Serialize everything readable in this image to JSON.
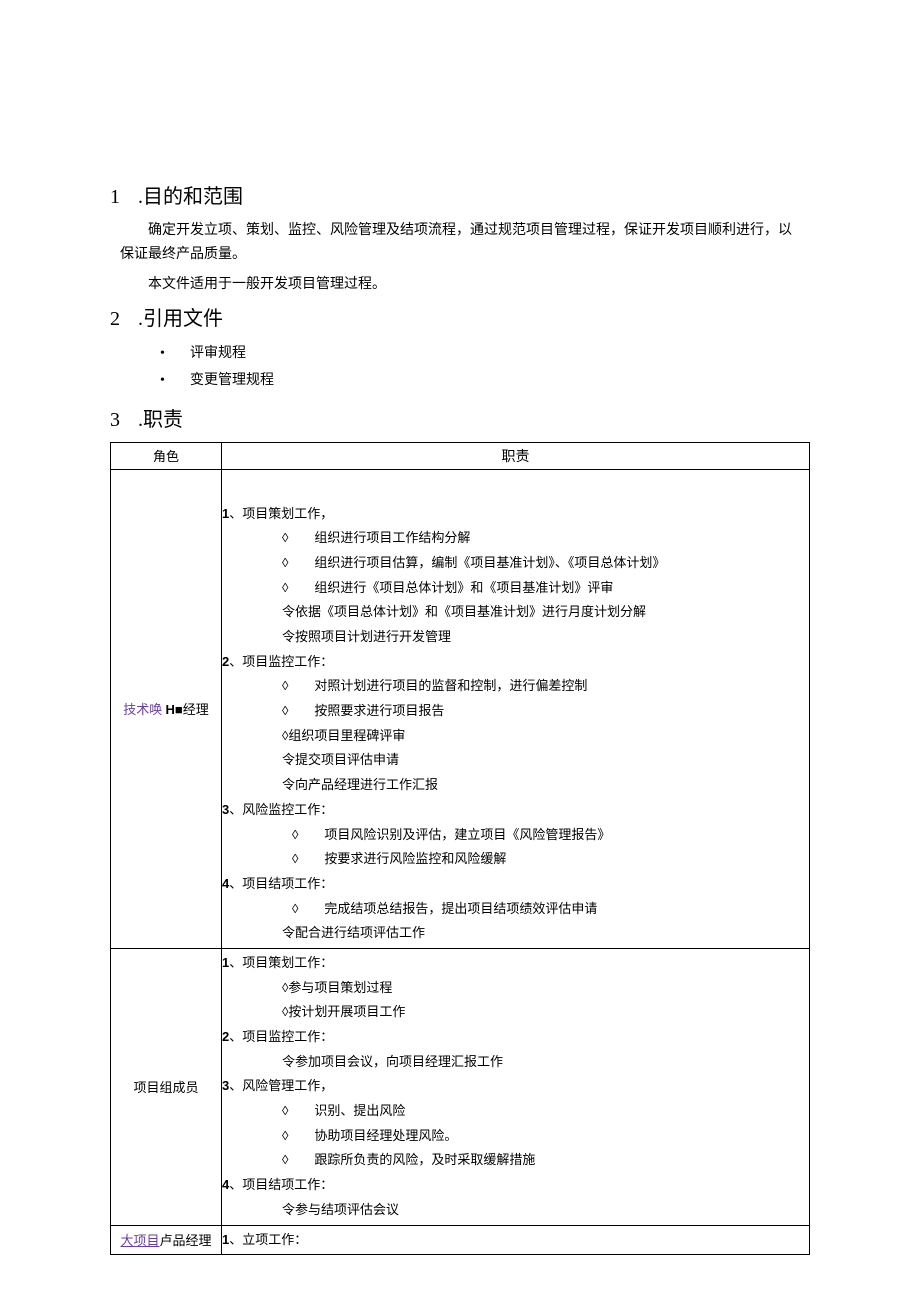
{
  "sections": {
    "s1": {
      "num": "1",
      "title": ".目的和范围",
      "p1": "确定开发立项、策划、监控、风险管理及结项流程，通过规范项目管理过程，保证开发项目顺利进行，以保证最终产品质量。",
      "p2": "本文件适用于一般开发项目管理过程。"
    },
    "s2": {
      "num": "2",
      "title": ".引用文件",
      "b1": "评审规程",
      "b2": "变更管理规程"
    },
    "s3": {
      "num": "3",
      "title": ".职责"
    }
  },
  "tableHeader": {
    "col1": "角色",
    "col2": "职责"
  },
  "rows": {
    "r1": {
      "role_p1": "技术唤 ",
      "role_bold": "H",
      "role_sq": "■",
      "role_p2": "经理",
      "sec1_head": "、项目策划工作，",
      "sec1_i1": "◊　　组织进行项目工作结构分解",
      "sec1_i2": "◊　　组织进行项目估算，编制《项目基准计划》、《项目总体计划》",
      "sec1_i3": "◊　　组织进行《项目总体计划》和《项目基准计划》评审",
      "sec1_i4": "令依据《项目总体计划》和《项目基准计划》进行月度计划分解",
      "sec1_i5": "令按照项目计划进行开发管理",
      "sec2_head": "、项目监控工作：",
      "sec2_i1": "◊　　对照计划进行项目的监督和控制，进行偏差控制",
      "sec2_i2": "◊　　按照要求进行项目报告",
      "sec2_i3": "◊组织项目里程碑评审",
      "sec2_i4": "令提交项目评估申请",
      "sec2_i5": "令向产品经理进行工作汇报",
      "sec3_head": "、风险监控工作：",
      "sec3_i1": "◊　　项目风险识别及评估，建立项目《风险管理报告》",
      "sec3_i2": "◊　　按要求进行风险监控和风险缓解",
      "sec4_head": "、项目结项工作：",
      "sec4_i1": "◊　　完成结项总结报告，提出项目结项绩效评估申请",
      "sec4_i2": "令配合进行结项评估工作"
    },
    "r2": {
      "role": "项目组成员",
      "sec1_head": "、项目策划工作：",
      "sec1_i1": "◊参与项目策划过程",
      "sec1_i2": "◊按计划开展项目工作",
      "sec2_head": "、项目监控工作：",
      "sec2_i1": "令参加项目会议，向项目经理汇报工作",
      "sec3_head": "、风险管理工作，",
      "sec3_i1": "◊　　识别、提出风险",
      "sec3_i2": "◊　　协助项目经理处理风险。",
      "sec3_i3": "◊　　跟踪所负责的风险，及时采取缓解措施",
      "sec4_head": "、项目结项工作：",
      "sec4_i1": "令参与结项评估会议"
    },
    "r3": {
      "role_link": "大项目",
      "role_rest": "卢品经理",
      "sec1_head": "、立项工作："
    }
  }
}
